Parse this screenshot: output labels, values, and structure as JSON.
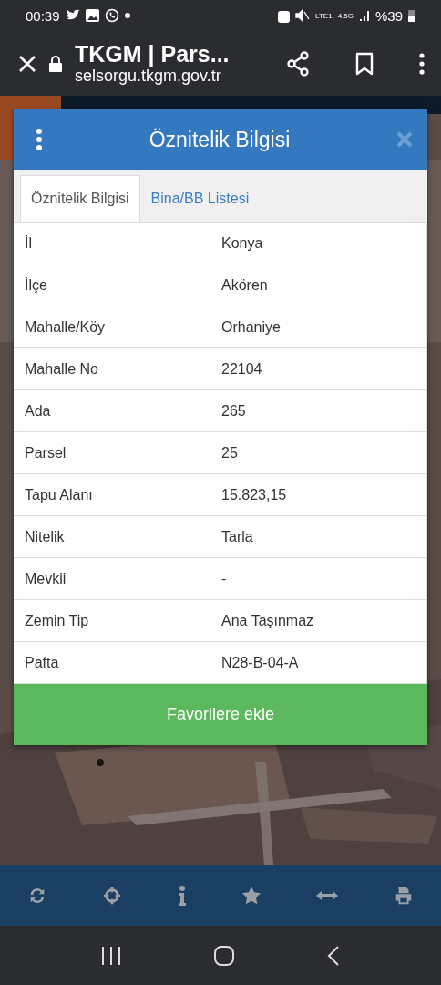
{
  "status_bar": {
    "time": "00:39",
    "network": "LTE1",
    "speed": "4.5G",
    "battery": "%39"
  },
  "browser": {
    "title": "TKGM | Pars...",
    "url": "selsorgu.tkgm.gov.tr"
  },
  "dialog": {
    "title": "Öznitelik Bilgisi",
    "tabs": [
      {
        "label": "Öznitelik Bilgisi",
        "selected": true
      },
      {
        "label": "Bina/BB Listesi",
        "selected": false
      }
    ],
    "rows": [
      {
        "label": "İl",
        "value": "Konya"
      },
      {
        "label": "İlçe",
        "value": "Akören"
      },
      {
        "label": "Mahalle/Köy",
        "value": "Orhaniye"
      },
      {
        "label": "Mahalle No",
        "value": "22104"
      },
      {
        "label": "Ada",
        "value": "265"
      },
      {
        "label": "Parsel",
        "value": "25"
      },
      {
        "label": "Tapu Alanı",
        "value": "15.823,15"
      },
      {
        "label": "Nitelik",
        "value": "Tarla"
      },
      {
        "label": "Mevkii",
        "value": "-"
      },
      {
        "label": "Zemin Tip",
        "value": "Ana Taşınmaz"
      },
      {
        "label": "Pafta",
        "value": "N28-B-04-A"
      }
    ],
    "button": "Favorilere ekle"
  },
  "toolbar": [
    {
      "kind": "refresh"
    },
    {
      "kind": "locate"
    },
    {
      "kind": "info"
    },
    {
      "kind": "star"
    },
    {
      "kind": "measure"
    },
    {
      "kind": "print"
    }
  ]
}
